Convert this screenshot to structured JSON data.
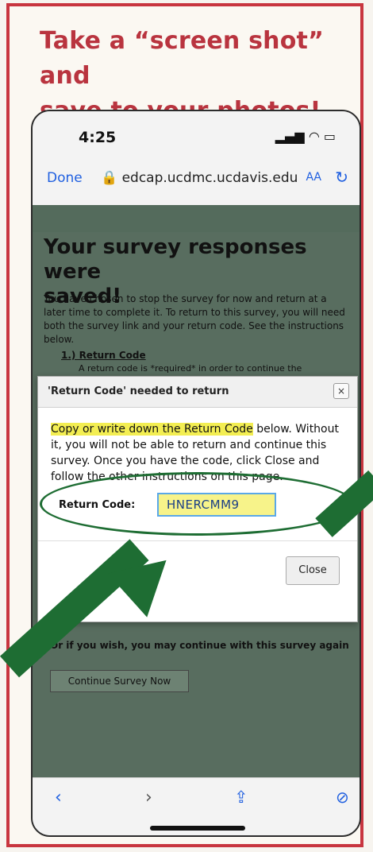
{
  "headline": {
    "line1": "Take a “screen shot” and",
    "line2": "save to your photos!"
  },
  "status_bar": {
    "time": "4:25",
    "icons": "signal wifi battery"
  },
  "browser": {
    "done_label": "Done",
    "lock_icon": "lock-icon",
    "url": "edcap.ucdmc.ucdavis.edu",
    "aa_label": "AA",
    "reload_icon": "reload-icon"
  },
  "page": {
    "title_line1": "Your survey responses were",
    "title_line2": "saved!",
    "intro_text": "You have chosen to stop the survey for now and return at a later time to complete it. To return to this survey, you will need both the survey link and your return code. See the instructions below.",
    "return_code_heading": "1.) Return Code",
    "return_code_note": "A return code is *required* in order to continue the",
    "continue_text": "Or if you wish, you may continue with this survey again",
    "continue_button": "Continue Survey Now"
  },
  "modal": {
    "title": "'Return Code' needed to return",
    "close_x": "×",
    "message_highlight": "Copy or write down the Return Code",
    "message_rest": " below. Without it, you will not be able to return and continue this survey. Once you have the code, click Close and follow the other instructions on this page.",
    "code_label": "Return Code:",
    "code_value": "HNERCMM9",
    "close_button": "Close"
  },
  "bottom_toolbar": {
    "back": "‹",
    "forward": "›",
    "share": "⇪",
    "compass": "⊘"
  },
  "colors": {
    "border": "#c8353f",
    "headline": "#b9343f",
    "overlay": "#586d5f",
    "annotation": "#1e6d33",
    "highlight": "#f3ee52",
    "ios_blue": "#1f5fe0"
  }
}
